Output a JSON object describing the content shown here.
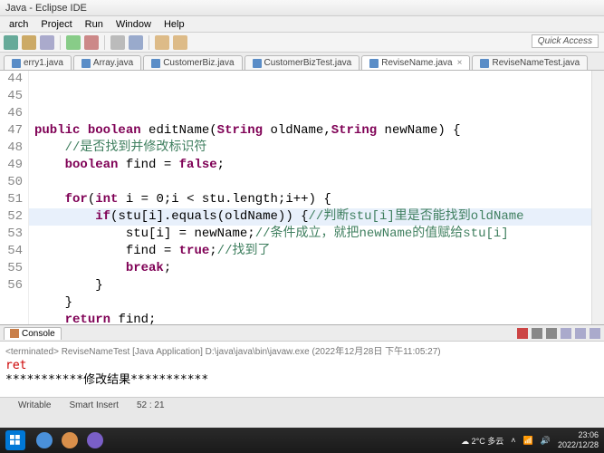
{
  "window": {
    "title": "Java - Eclipse IDE"
  },
  "menu": {
    "items": [
      "arch",
      "Project",
      "Run",
      "Window",
      "Help"
    ]
  },
  "quick_access": "Quick Access",
  "tabs": [
    {
      "label": "erry1.java",
      "active": false
    },
    {
      "label": "Array.java",
      "active": false
    },
    {
      "label": "CustomerBiz.java",
      "active": false
    },
    {
      "label": "CustomerBizTest.java",
      "active": false
    },
    {
      "label": "ReviseName.java",
      "active": true
    },
    {
      "label": "ReviseNameTest.java",
      "active": false
    }
  ],
  "editor": {
    "first_line_visible": 44,
    "highlighted_line": 52,
    "lines": [
      {
        "n": 44,
        "raw": "public boolean editName(String oldName,String newName) {",
        "partial_top": true
      },
      {
        "n": 45,
        "raw": "    //是否找到并修改标识符"
      },
      {
        "n": 46,
        "raw": "    boolean find = false;"
      },
      {
        "n": 47,
        "raw": ""
      },
      {
        "n": 48,
        "raw": "    for(int i = 0;i < stu.length;i++) {"
      },
      {
        "n": 49,
        "raw": "        if(stu[i].equals(oldName)) {//判断stu[i]里是否能找到oldName"
      },
      {
        "n": 50,
        "raw": "            stu[i] = newName;//条件成立，就把newName的值赋给stu[i]"
      },
      {
        "n": 51,
        "raw": "            find = true;//找到了"
      },
      {
        "n": 52,
        "raw": "            break;"
      },
      {
        "n": 53,
        "raw": "        }"
      },
      {
        "n": 54,
        "raw": "    }"
      },
      {
        "n": 55,
        "raw": "    return find;"
      },
      {
        "n": 56,
        "raw": "}"
      }
    ]
  },
  "console": {
    "tab_label": "Console",
    "header": "<terminated> ReviseNameTest [Java Application] D:\\java\\java\\bin\\javaw.exe (2022年12月28日 下午11:05:27)",
    "output_lines": [
      "ret",
      "***********修改结果***********"
    ]
  },
  "statusbar": {
    "writable": "Writable",
    "insert": "Smart Insert",
    "pos": "52 : 21"
  },
  "taskbar": {
    "weather": "2°C 多云",
    "time": "23:06",
    "date": "2022/12/28"
  }
}
